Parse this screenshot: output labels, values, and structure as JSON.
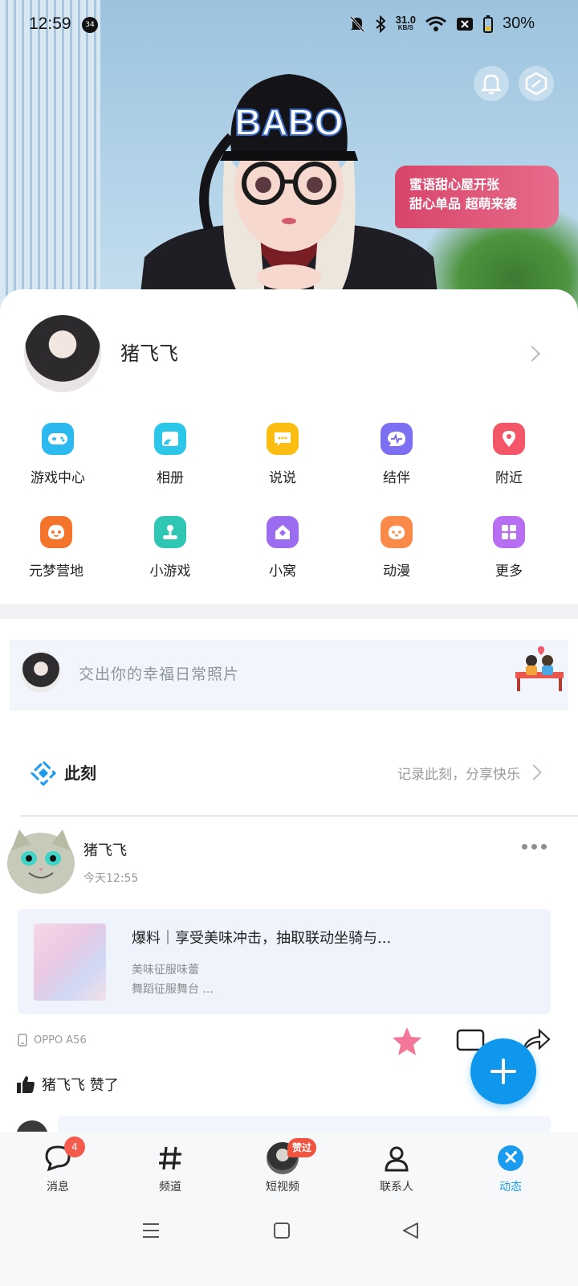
{
  "status_bar": {
    "time": "12:59",
    "notification_count": "34",
    "speed_value": "31.0",
    "speed_unit": "KB/S",
    "battery": "30%"
  },
  "hero": {
    "cap_text": "BABO",
    "promo_line1": "蜜语甜心屋开张",
    "promo_line2": "甜心单品 超萌来袭"
  },
  "profile": {
    "name": "猪飞飞"
  },
  "grid": {
    "items": [
      {
        "label": "游戏中心",
        "icon": "gamepad-icon",
        "color": "#2bb9f0"
      },
      {
        "label": "相册",
        "icon": "album-icon",
        "color": "#2cc6e8"
      },
      {
        "label": "说说",
        "icon": "chat-icon",
        "color": "#fbbd12"
      },
      {
        "label": "结伴",
        "icon": "pulse-icon",
        "color": "#7c6ff2"
      },
      {
        "label": "附近",
        "icon": "location-icon",
        "color": "#f25668"
      },
      {
        "label": "元梦营地",
        "icon": "camp-icon",
        "color": "#f5742b"
      },
      {
        "label": "小游戏",
        "icon": "joystick-icon",
        "color": "#2fc7b4"
      },
      {
        "label": "小窝",
        "icon": "home-icon",
        "color": "#9b6cf0"
      },
      {
        "label": "动漫",
        "icon": "anime-icon",
        "color": "#f98a4a"
      },
      {
        "label": "更多",
        "icon": "more-grid-icon",
        "color": "#b86ef2"
      }
    ]
  },
  "composer": {
    "placeholder": "交出你的幸福日常照片"
  },
  "moment": {
    "title": "此刻",
    "hint": "记录此刻，分享快乐"
  },
  "feed": {
    "author": "猪飞飞",
    "time": "今天12:55",
    "share_title": "爆料｜享受美味冲击，抽取联动坐骑与...",
    "share_sub1": "美味征服味蕾",
    "share_sub2": "舞蹈征服舞台 ...",
    "device": "OPPO A56",
    "liked_by": "猪飞飞 赞了"
  },
  "bottom_nav": {
    "items": [
      {
        "label": "消息",
        "badge": "4"
      },
      {
        "label": "频道"
      },
      {
        "label": "短视频",
        "badge": "赞过"
      },
      {
        "label": "联系人"
      },
      {
        "label": "动态"
      }
    ],
    "active_color": "#1b9cf0"
  }
}
